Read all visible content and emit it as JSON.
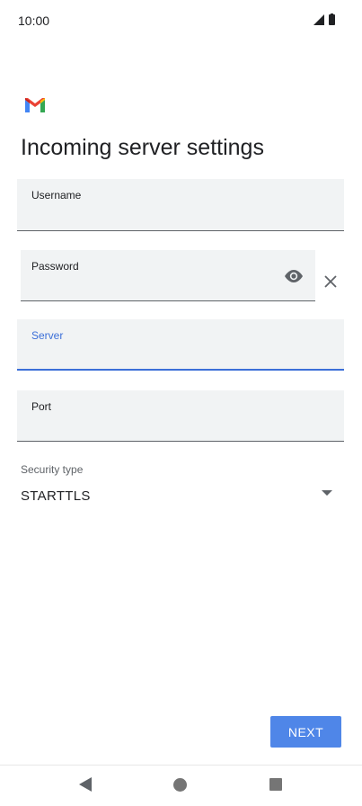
{
  "status_bar": {
    "time": "10:00",
    "icons": [
      "signal-icon",
      "battery-icon"
    ]
  },
  "app": {
    "logo": "gmail-logo-icon",
    "brand_colors": {
      "red": "#ea4335",
      "blue": "#4285f4",
      "green": "#34a853",
      "yellow": "#fbbc04"
    }
  },
  "page": {
    "title": "Incoming server settings"
  },
  "form": {
    "username": {
      "label": "Username",
      "value": ""
    },
    "password": {
      "label": "Password",
      "value": "",
      "show_password_icon": "eye-icon",
      "clear_icon": "close-icon"
    },
    "server": {
      "label": "Server",
      "value": "",
      "focused": true
    },
    "port": {
      "label": "Port",
      "value": ""
    },
    "security_type": {
      "label": "Security type",
      "selected": "STARTTLS",
      "icon": "dropdown-arrow-icon"
    }
  },
  "actions": {
    "next_label": "NEXT"
  },
  "colors": {
    "accent": "#3c6fd8",
    "button": "#4f86e8",
    "field_bg": "#f1f3f4"
  },
  "nav_bar": {
    "icons": [
      "back-icon",
      "home-icon",
      "recents-icon"
    ]
  }
}
